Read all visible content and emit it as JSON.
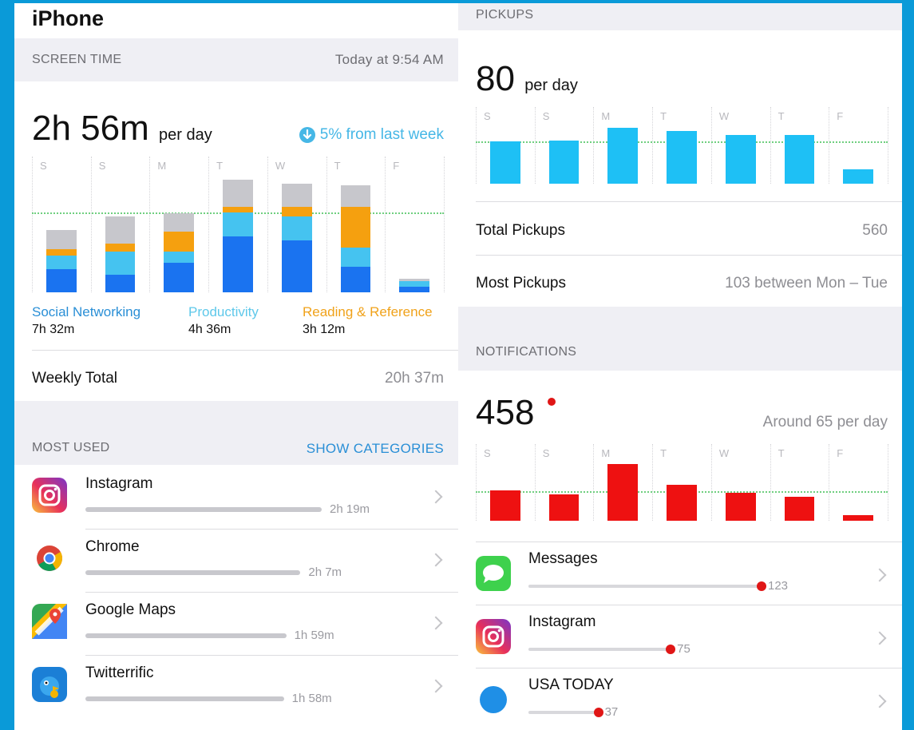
{
  "screen_time": {
    "device_title": "iPhone",
    "section_caption": "SCREEN TIME",
    "timestamp": "Today at 9:54 AM",
    "total": "2h 56m",
    "total_unit": "per day",
    "trend": "5% from last week",
    "days": [
      "S",
      "S",
      "M",
      "T",
      "W",
      "T",
      "F"
    ],
    "average_fraction": 0.59,
    "colors": {
      "social": "#1a73f0",
      "productivity": "#45c3f0",
      "reading": "#f5a00f",
      "other": "#c7c7cc"
    },
    "bars": [
      {
        "social": 0.17,
        "productivity": 0.1,
        "reading": 0.05,
        "other": 0.14
      },
      {
        "social": 0.13,
        "productivity": 0.17,
        "reading": 0.06,
        "other": 0.2
      },
      {
        "social": 0.22,
        "productivity": 0.08,
        "reading": 0.15,
        "other": 0.13
      },
      {
        "social": 0.41,
        "productivity": 0.18,
        "reading": 0.04,
        "other": 0.2
      },
      {
        "social": 0.38,
        "productivity": 0.18,
        "reading": 0.07,
        "other": 0.17
      },
      {
        "social": 0.19,
        "productivity": 0.14,
        "reading": 0.3,
        "other": 0.16
      },
      {
        "social": 0.04,
        "productivity": 0.04,
        "reading": 0.0,
        "other": 0.02
      }
    ],
    "legend": [
      {
        "label": "Social Networking",
        "value": "7h 32m",
        "color": "#2a8fd6"
      },
      {
        "label": "Productivity",
        "value": "4h 36m",
        "color": "#5ec8ea"
      },
      {
        "label": "Reading & Reference",
        "value": "3h 12m",
        "color": "#f0a21a"
      }
    ],
    "weekly_total_label": "Weekly Total",
    "weekly_total_value": "20h 37m"
  },
  "most_used": {
    "caption": "MOST USED",
    "show_categories": "SHOW CATEGORIES",
    "apps": [
      {
        "name": "Instagram",
        "time": "2h 19m",
        "fraction": 1.0,
        "icon": "instagram-icon"
      },
      {
        "name": "Chrome",
        "time": "2h 7m",
        "fraction": 0.91,
        "icon": "chrome-icon"
      },
      {
        "name": "Google Maps",
        "time": "1h 59m",
        "fraction": 0.85,
        "icon": "google-maps-icon"
      },
      {
        "name": "Twitterrific",
        "time": "1h 58m",
        "fraction": 0.84,
        "icon": "twitterrific-icon"
      }
    ]
  },
  "pickups": {
    "caption": "PICKUPS",
    "total": "80",
    "unit": "per day",
    "days": [
      "S",
      "S",
      "M",
      "T",
      "W",
      "T",
      "F"
    ],
    "bar_color": "#1ec0f5",
    "average_fraction": 0.55,
    "values": [
      0.55,
      0.56,
      0.73,
      0.69,
      0.64,
      0.64,
      0.19
    ],
    "total_label": "Total Pickups",
    "total_value": "560",
    "most_label": "Most Pickups",
    "most_value": "103 between Mon – Tue"
  },
  "notifications": {
    "caption": "NOTIFICATIONS",
    "total": "458",
    "per_day": "Around 65 per day",
    "days": [
      "S",
      "S",
      "M",
      "T",
      "W",
      "T",
      "F"
    ],
    "bar_color": "#ee1111",
    "average_fraction": 0.39,
    "values": [
      0.4,
      0.34,
      0.74,
      0.47,
      0.36,
      0.31,
      0.07
    ],
    "apps": [
      {
        "name": "Messages",
        "count": "123",
        "fraction": 1.0,
        "icon": "messages-icon"
      },
      {
        "name": "Instagram",
        "count": "75",
        "fraction": 0.61,
        "icon": "instagram-icon"
      },
      {
        "name": "USA TODAY",
        "count": "37",
        "fraction": 0.3,
        "icon": "usa-today-icon"
      }
    ]
  }
}
